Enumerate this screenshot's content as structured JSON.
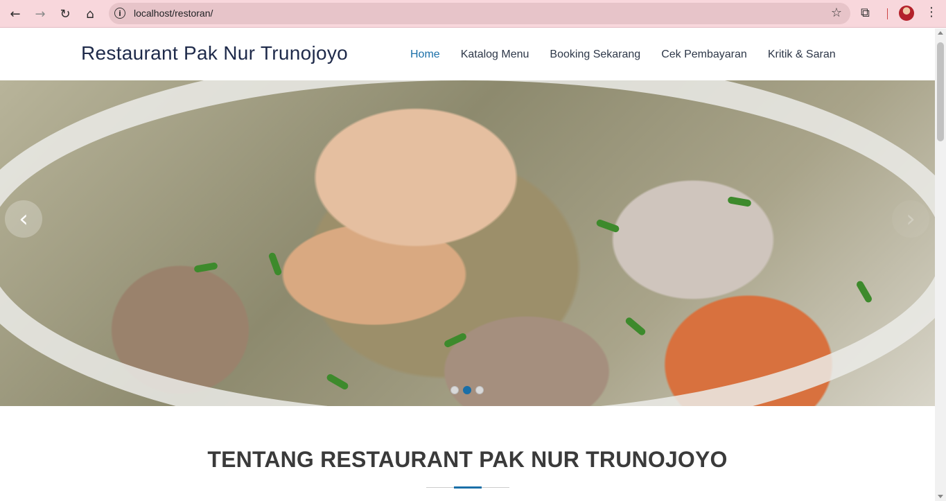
{
  "browser": {
    "url": "localhost/restoran/",
    "back_icon": "arrow-left-icon",
    "forward_icon": "arrow-right-icon",
    "reload_icon": "reload-icon",
    "home_icon": "home-icon"
  },
  "site": {
    "brand": "Restaurant Pak Nur Trunojoyo",
    "menu": [
      {
        "label": "Home",
        "active": true
      },
      {
        "label": "Katalog Menu",
        "active": false
      },
      {
        "label": "Booking Sekarang",
        "active": false
      },
      {
        "label": "Cek Pembayaran",
        "active": false
      },
      {
        "label": "Kritik & Saran",
        "active": false
      }
    ],
    "accent_color": "#1a6fa8"
  },
  "carousel": {
    "slide_count": 3,
    "active_index": 1,
    "prev_icon": "chevron-left-icon",
    "next_icon": "chevron-right-icon"
  },
  "about": {
    "title": "TENTANG RESTAURANT PAK NUR TRUNOJOYO"
  }
}
